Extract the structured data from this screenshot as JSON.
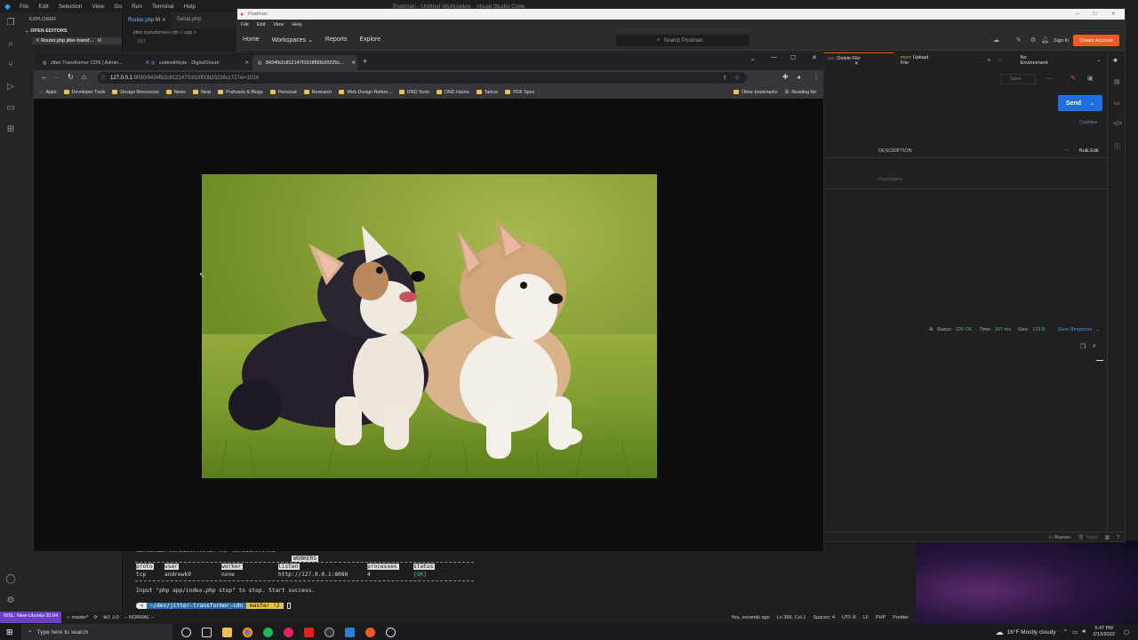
{
  "vscode": {
    "menu": [
      "File",
      "Edit",
      "Selection",
      "View",
      "Go",
      "Run",
      "Terminal",
      "Help"
    ],
    "window_title": "Postman - Untitled Workspace - Visual Studio Code",
    "explorer_label": "EXPLORER",
    "open_editors_label": "OPEN EDITORS",
    "open_file": "Router.php jitter-transf...",
    "open_file_badge": "M",
    "tabs": [
      {
        "label": "Router.php",
        "badge": "M"
      },
      {
        "label": "Setup.php"
      }
    ],
    "breadcrumb": "jitter-transformer-cdn > app >",
    "editor_line_numbers": [
      "281"
    ],
    "terminal": {
      "header": "Workerman version:4.0.27          PHP version:7.4.3",
      "workers_tag": "WORKERS",
      "columns": [
        "proto",
        "user",
        "worker",
        "listen",
        "processes",
        "status"
      ],
      "row": [
        "tcp",
        "andrewk9",
        "none",
        "http://127.0.0.1:8080",
        "4",
        "[OK]"
      ],
      "message": "Input \"php app/index.php stop\" to stop. Start success.",
      "prompt_path": "~/dev/jitter-transformer-cdn",
      "prompt_branch": "master !2"
    },
    "statusbar": {
      "remote": "WSL: New-Ubuntu-20.04",
      "branch": "master*",
      "errors": "0",
      "warnings": "0",
      "mode": "-- NORMAL --",
      "author": "You, seconds ago",
      "position": "Ln 366, Col 1",
      "spaces": "Spaces: 4",
      "encoding": "UTF-8",
      "eol": "LF",
      "language": "PHP",
      "prettier": "Prettier"
    }
  },
  "postman": {
    "title": "Postman",
    "menu": [
      "File",
      "Edit",
      "View",
      "Help"
    ],
    "nav": [
      "Home",
      "Workspaces",
      "Reports",
      "Explore"
    ],
    "search_placeholder": "Search Postman",
    "sign_in": "Sign In",
    "create_account": "Create Account",
    "tabs": [
      {
        "method": "DEL",
        "label": "Delete File"
      },
      {
        "method": "POST",
        "label": "Upload File"
      }
    ],
    "environment": "No Environment",
    "save": "Save",
    "send": "Send",
    "cookies": "Cookies",
    "description_header": "DESCRIPTION",
    "bulk_edit": "Bulk Edit",
    "description_placeholder": "Description",
    "status": "Status:",
    "status_value": "200 OK",
    "time": "Time:",
    "time_value": "397 ms",
    "size": "Size:",
    "size_value": "123 B",
    "save_response": "Save Response",
    "runner": "Runner",
    "trash": "Trash"
  },
  "chrome": {
    "tabs": [
      {
        "label": "Jitter Transformer CDN | Admin..."
      },
      {
        "label": "codewithkyle - DigitalOcean"
      },
      {
        "label": "8434fb2c812147f1918f00b20226c..."
      }
    ],
    "url_host": "127.0.0.1",
    "url_rest": ":8080/8434fb2c812147f1918f00b20226cc727w=1024",
    "bookmarks": [
      "Apps",
      "Developer Tools",
      "Design Resources",
      "News",
      "Neat",
      "Podcasts & Blogs",
      "Personal",
      "Research",
      "Web Design Refere...",
      "DND Tools",
      "DND Hacks",
      "Tarkov",
      "PDF Spec"
    ],
    "other_bookmarks": "Other bookmarks",
    "reading_list": "Reading list"
  },
  "taskbar": {
    "search_placeholder": "Type here to search",
    "weather": "16°F  Mostly cloudy",
    "time": "5:47 PM",
    "date": "2/13/2022"
  },
  "colors": {
    "postman_orange": "#ef5b25",
    "send_blue": "#1f6fe0",
    "status_green": "#3fbf5f",
    "vscode_bg": "#1e1e1e"
  }
}
